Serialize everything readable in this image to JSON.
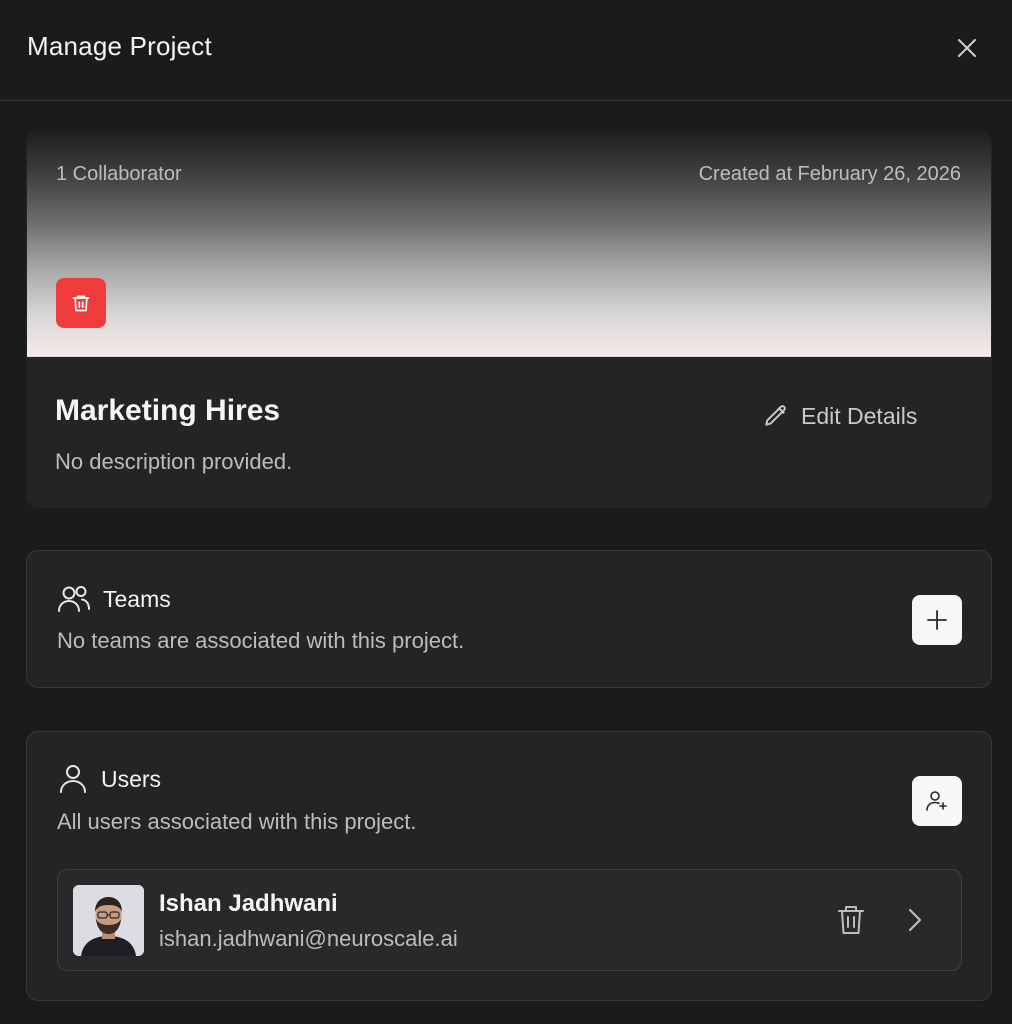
{
  "header": {
    "title": "Manage Project"
  },
  "project": {
    "collaborators": "1 Collaborator",
    "created": "Created at February 26, 2026",
    "name": "Marketing Hires",
    "description": "No description provided.",
    "edit_label": "Edit Details",
    "banner_colors": [
      "#1e1e20",
      "#f6eaea"
    ],
    "delete_color": "#ef3b3b"
  },
  "teams": {
    "title": "Teams",
    "subtitle": "No teams are associated with this project."
  },
  "users": {
    "title": "Users",
    "subtitle": "All users associated with this project.",
    "list": [
      {
        "name": "Ishan Jadhwani",
        "email": "ishan.jadhwani@neuroscale.ai"
      }
    ]
  },
  "icons": [
    "close-icon",
    "trash-icon",
    "pencil-icon",
    "users-group-icon",
    "plus-icon",
    "user-icon",
    "user-plus-icon",
    "chevron-right-icon"
  ]
}
